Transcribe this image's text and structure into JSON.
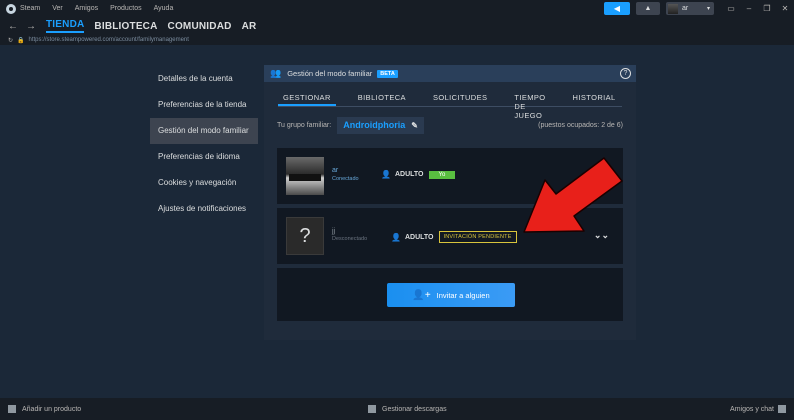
{
  "menubar": {
    "items": [
      "Steam",
      "Ver",
      "Amigos",
      "Productos",
      "Ayuda"
    ],
    "user_name": "ar"
  },
  "nav": {
    "tabs": [
      "TIENDA",
      "BIBLIOTECA",
      "COMUNIDAD",
      "AR"
    ],
    "active_tab": "TIENDA",
    "url": "https://store.steampowered.com/account/familymanagement"
  },
  "sidebar": {
    "items": [
      {
        "label": "Detalles de la cuenta"
      },
      {
        "label": "Preferencias de la tienda"
      },
      {
        "label": "Gestión del modo familiar"
      },
      {
        "label": "Preferencias de idioma"
      },
      {
        "label": "Cookies y navegación"
      },
      {
        "label": "Ajustes de notificaciones"
      }
    ],
    "active_index": 2
  },
  "panel": {
    "title": "Gestión del modo familiar",
    "beta": "BETA",
    "help": "?",
    "tabs": [
      "GESTIONAR",
      "BIBLIOTECA",
      "SOLICITUDES",
      "TIEMPO DE JUEGO",
      "HISTORIAL"
    ],
    "group_label": "Tu grupo familiar:",
    "group_name": "Androidphoria",
    "slots": "(puestos ocupados: 2 de 6)",
    "members": [
      {
        "name": "ar",
        "status": "Conectado",
        "role": "ADULTO",
        "badge": "Yo"
      },
      {
        "name": "jj",
        "status": "Desconectado",
        "role": "ADULTO",
        "badge": "INVITACIÓN PENDIENTE",
        "avatar_glyph": "?"
      }
    ],
    "invite_label": "Invitar a alguien"
  },
  "bottombar": {
    "add_product": "Añadir un producto",
    "downloads": "Gestionar descargas",
    "friends": "Amigos y chat"
  },
  "colors": {
    "accent": "#1a9fff",
    "background": "#1b2838",
    "yo_badge": "#59bf40",
    "pending_badge": "#d8c43c",
    "annotation_arrow": "#e8201a"
  }
}
